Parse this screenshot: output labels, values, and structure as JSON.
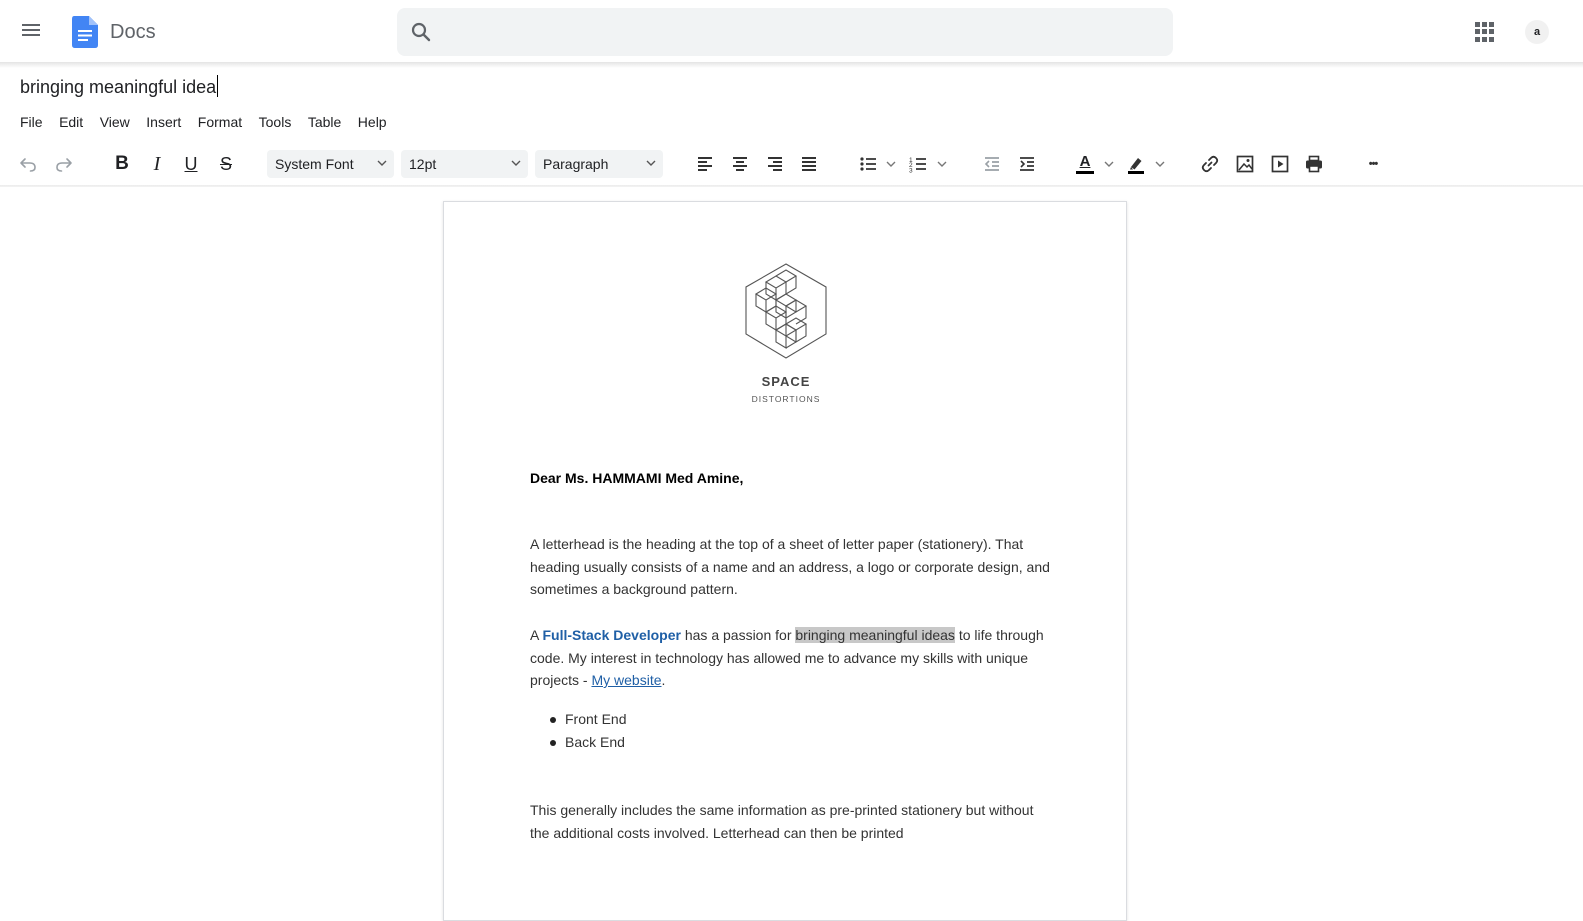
{
  "app": {
    "name": "Docs"
  },
  "search": {
    "placeholder": ""
  },
  "user": {
    "avatar_initial": "a"
  },
  "document": {
    "title": "bringing meaningful idea"
  },
  "menu": [
    "File",
    "Edit",
    "View",
    "Insert",
    "Format",
    "Tools",
    "Table",
    "Help"
  ],
  "toolbar": {
    "font_family": "System Font",
    "font_size": "12pt",
    "block_style": "Paragraph",
    "bold_glyph": "B",
    "italic_glyph": "I",
    "underline_glyph": "U",
    "strike_glyph": "S",
    "more_glyph": "•••",
    "text_color_glyph": "A"
  },
  "letter": {
    "brand_name": "SPACE",
    "brand_sub": "DISTORTIONS",
    "salutation": "Dear Ms. HAMMAMI Med Amine,",
    "p1": "A letterhead is the heading at the top of a sheet of letter paper (stationery). That heading usually consists of a name and an address, a logo or corporate design, and sometimes a background pattern.",
    "p2_a": "A ",
    "p2_role": "Full-Stack Developer",
    "p2_b": " has a passion for ",
    "p2_highlight": "bringing meaningful ideas",
    "p2_c": " to life through code. My interest in technology has allowed me to advance my skills with unique projects - ",
    "p2_link": "My website",
    "p2_end": ".",
    "bullets": [
      "Front End",
      "Back End"
    ],
    "p3": "This generally includes the same information as pre-printed stationery but without the additional costs involved. Letterhead can then be printed"
  },
  "colors": {
    "accent": "#1f5fa6",
    "docs_blue": "#4285f4",
    "highlight": "#c8c8c8"
  }
}
